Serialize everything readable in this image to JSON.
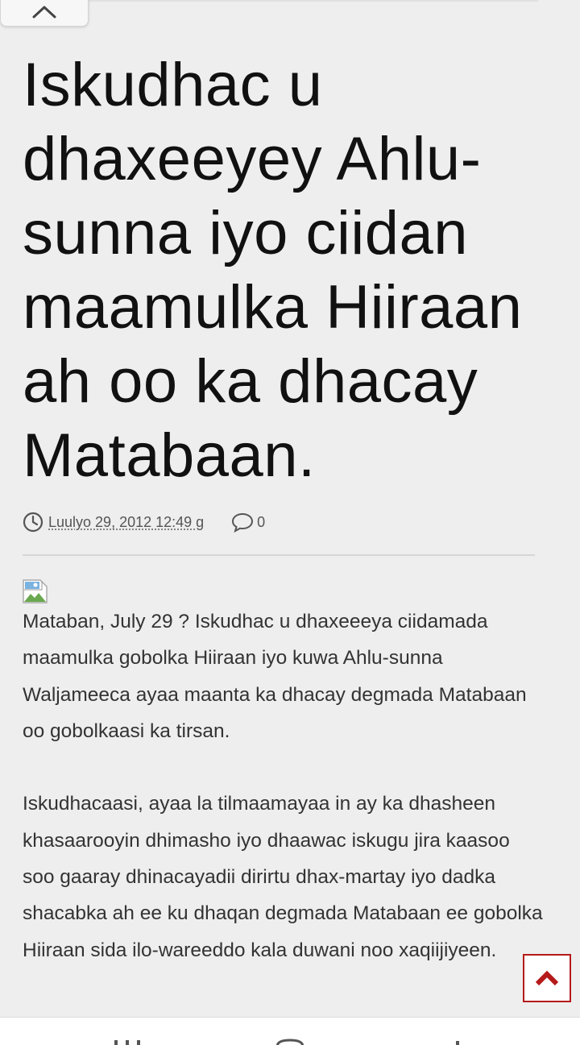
{
  "header": {
    "close_icon": "chevron-up-icon"
  },
  "article": {
    "title": "Iskudhac u dhaxeeyey Ahlu-sunna iyo ciidan maamulka Hiiraan ah oo ka dhacay Matabaan.",
    "date": "Luulyo 29, 2012 12:49 g",
    "comment_count": "0",
    "image_icon": "broken-image-icon",
    "paragraphs": [
      "Mataban, July 29 ? Iskudhac u dhaxeeeya ciidamada maamulka gobolka Hiiraan iyo kuwa Ahlu-sunna Waljameeca ayaa maanta ka dhacay degmada Matabaan oo gobolkaasi ka tirsan.",
      "Iskudhacaasi, ayaa la tilmaamayaa in ay ka dhasheen khasaarooyin dhimasho iyo dhaawac iskugu jira kaasoo soo gaaray dhinacayadii dirirtu dhax-martay iyo dadka shacabka ah ee ku dhaqan degmada Matabaan ee gobolka Hiiraan sida ilo-wareeddo kala duwani noo xaqiijiyeen."
    ]
  },
  "scroll_top": {
    "icon": "chevron-up-icon",
    "color": "#b51a1a"
  },
  "colors": {
    "background": "#eeeeee",
    "title": "#111111",
    "body_text": "#333333",
    "accent": "#b51a1a"
  }
}
